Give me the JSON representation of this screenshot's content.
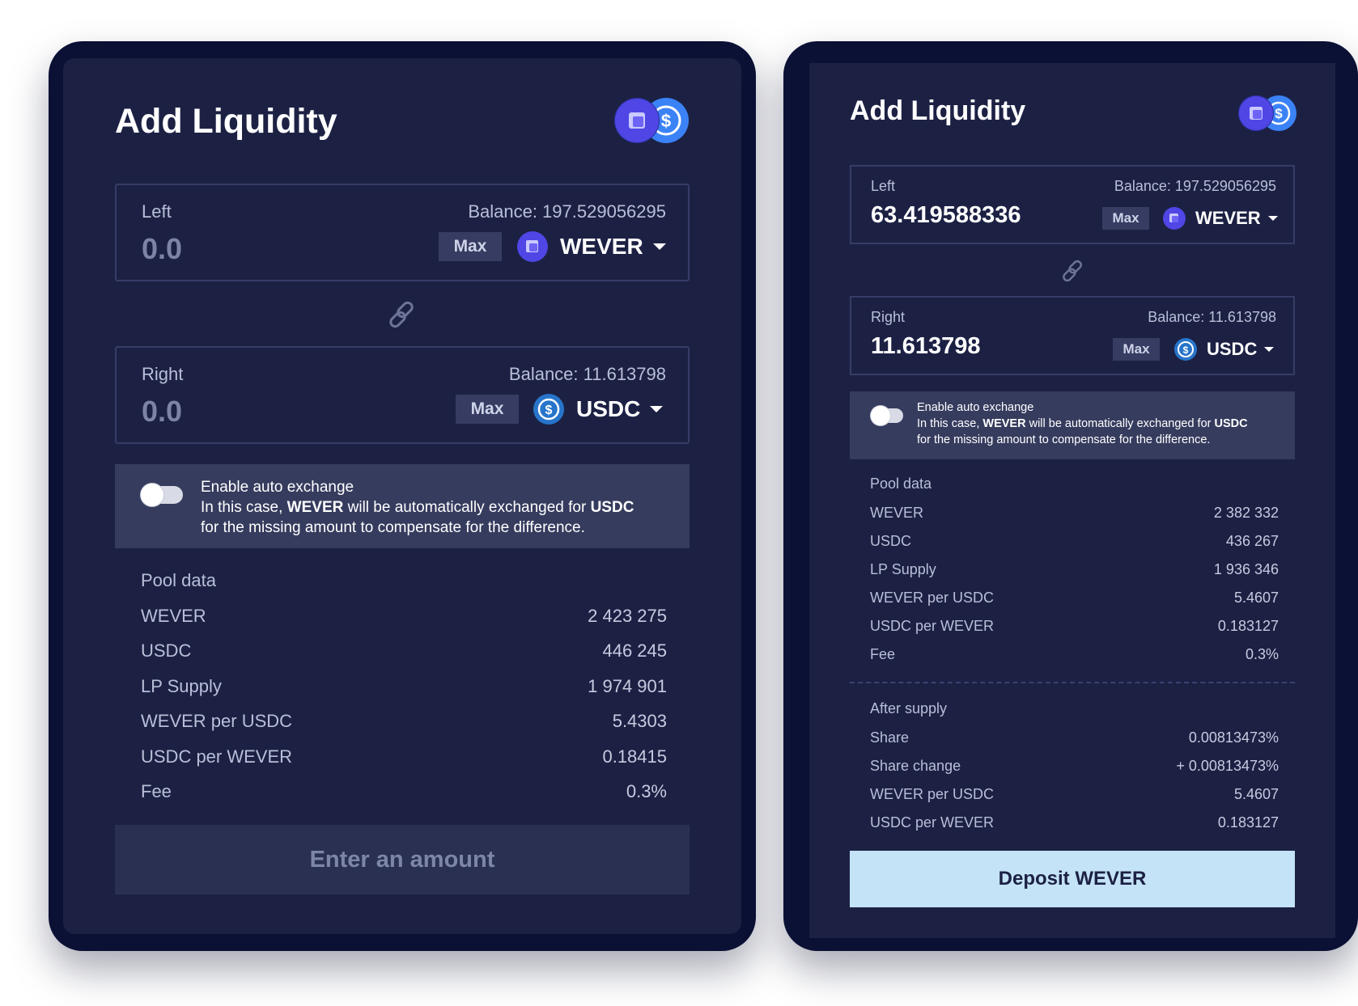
{
  "left_card": {
    "title": "Add Liquidity",
    "left_field": {
      "label": "Left",
      "balance": "Balance: 197.529056295",
      "value": "0.0",
      "max": "Max",
      "token": "WEVER",
      "token_icon": "wever-icon"
    },
    "right_field": {
      "label": "Right",
      "balance": "Balance: 11.613798",
      "value": "0.0",
      "max": "Max",
      "token": "USDC",
      "token_icon": "usdc-icon"
    },
    "auto_exchange": {
      "title": "Enable auto exchange",
      "line2_prefix": "In this case, ",
      "from_token": "WEVER",
      "line2_middle": " will be automatically exchanged for ",
      "to_token": "USDC",
      "line3": "for the missing amount to compensate for the difference.",
      "enabled": false
    },
    "pool_data": {
      "title": "Pool data",
      "rows": [
        {
          "label": "WEVER",
          "value": "2 423 275"
        },
        {
          "label": "USDC",
          "value": "446 245"
        },
        {
          "label": "LP Supply",
          "value": "1 974 901"
        },
        {
          "label": "WEVER per USDC",
          "value": "5.4303"
        },
        {
          "label": "USDC per WEVER",
          "value": "0.18415"
        },
        {
          "label": "Fee",
          "value": "0.3%"
        }
      ]
    },
    "cta": "Enter an amount"
  },
  "right_card": {
    "title": "Add Liquidity",
    "left_field": {
      "label": "Left",
      "balance": "Balance: 197.529056295",
      "value": "63.419588336",
      "max": "Max",
      "token": "WEVER",
      "token_icon": "wever-icon"
    },
    "right_field": {
      "label": "Right",
      "balance": "Balance: 11.613798",
      "value": "11.613798",
      "max": "Max",
      "token": "USDC",
      "token_icon": "usdc-icon"
    },
    "auto_exchange": {
      "title": "Enable auto exchange",
      "line2_prefix": "In this case, ",
      "from_token": "WEVER",
      "line2_middle": " will be automatically exchanged for ",
      "to_token": "USDC",
      "line3": "for the missing amount to compensate for the difference.",
      "enabled": false
    },
    "pool_data": {
      "title": "Pool data",
      "rows": [
        {
          "label": "WEVER",
          "value": "2 382 332"
        },
        {
          "label": "USDC",
          "value": "436 267"
        },
        {
          "label": "LP Supply",
          "value": "1 936 346"
        },
        {
          "label": "WEVER per USDC",
          "value": "5.4607"
        },
        {
          "label": "USDC per WEVER",
          "value": "0.183127"
        },
        {
          "label": "Fee",
          "value": "0.3%"
        }
      ]
    },
    "after_supply": {
      "title": "After supply",
      "rows": [
        {
          "label": "Share",
          "value": "0.00813473%"
        },
        {
          "label": "Share change",
          "value": "+ 0.00813473%"
        },
        {
          "label": "WEVER per USDC",
          "value": "5.4607"
        },
        {
          "label": "USDC per WEVER",
          "value": "0.183127"
        }
      ]
    },
    "cta": "Deposit WEVER"
  },
  "colors": {
    "frame": "#0b1035",
    "panel": "#1c2144",
    "field_border": "#363c66",
    "notice_bg": "#363c5e",
    "wever": "#4f46e5",
    "usdc": "#2775ca",
    "cta_enabled": "#c4e3f6",
    "cta_disabled": "#2a3052"
  }
}
